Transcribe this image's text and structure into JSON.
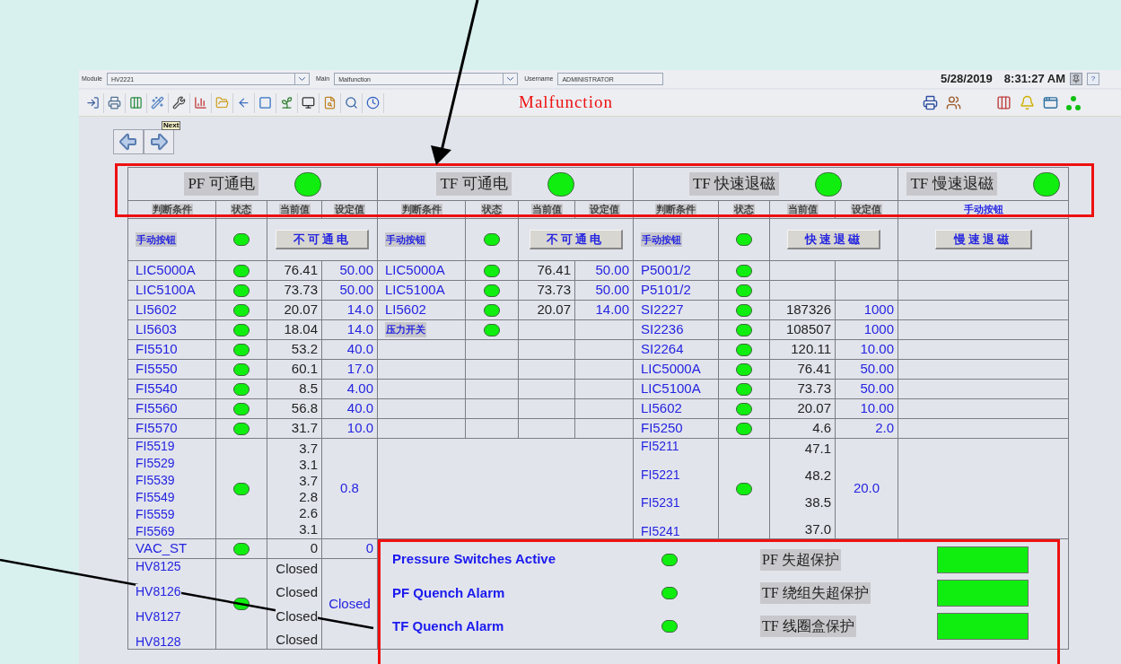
{
  "top_bar": {
    "module_label": "Module",
    "module": "HV2221",
    "main_label": "Main",
    "main": "Malfunction",
    "username_label": "Username",
    "username": "ADMINISTRATOR",
    "date": "5/28/2019",
    "time": "8:31:27 AM",
    "help": "?"
  },
  "page_title": "Malfunction",
  "next_tooltip": "Next",
  "sections": [
    {
      "title": "PF 可通电",
      "on": true,
      "columns": [
        {
          "label": "判断条件",
          "kind": "plain"
        },
        {
          "label": "状态",
          "kind": "plain"
        },
        {
          "label": "当前值",
          "kind": "plain"
        },
        {
          "label": "设定值",
          "kind": "plain"
        }
      ],
      "manual_label": "手动按钮",
      "manual_on": true,
      "button": "不可通电"
    },
    {
      "title": "TF 可通电",
      "on": true,
      "columns": [
        {
          "label": "判断条件",
          "kind": "plain"
        },
        {
          "label": "状态",
          "kind": "plain"
        },
        {
          "label": "当前值",
          "kind": "plain"
        },
        {
          "label": "设定值",
          "kind": "plain"
        }
      ],
      "manual_label": "手动按钮",
      "manual_on": true,
      "button": "不可通电"
    },
    {
      "title": "TF 快速退磁",
      "on": true,
      "columns": [
        {
          "label": "判断条件",
          "kind": "plain"
        },
        {
          "label": "状态",
          "kind": "plain"
        },
        {
          "label": "当前值",
          "kind": "plain"
        },
        {
          "label": "设定值",
          "kind": "plain"
        }
      ],
      "manual_label": "手动按钮",
      "manual_on": true,
      "button": "快速退磁"
    },
    {
      "title": "TF 慢速退磁",
      "on": true,
      "columns": [
        {
          "label": "手动按钮",
          "kind": "link"
        }
      ],
      "button": "慢速退磁"
    }
  ],
  "pf_rows": [
    {
      "kind": "single",
      "tag": "LIC5000A",
      "on": true,
      "value": "76.41",
      "setpoint": "50.00"
    },
    {
      "kind": "single",
      "tag": "LIC5100A",
      "on": true,
      "value": "73.73",
      "setpoint": "50.00"
    },
    {
      "kind": "single",
      "tag": "LI5602",
      "on": true,
      "value": "20.07",
      "setpoint": "14.0"
    },
    {
      "kind": "single",
      "tag": "LI5603",
      "on": true,
      "value": "18.04",
      "setpoint": "14.0"
    },
    {
      "kind": "single",
      "tag": "FI5510",
      "on": true,
      "value": "53.2",
      "setpoint": "40.0"
    },
    {
      "kind": "single",
      "tag": "FI5550",
      "on": true,
      "value": "60.1",
      "setpoint": "17.0"
    },
    {
      "kind": "single",
      "tag": "FI5540",
      "on": true,
      "value": "8.5",
      "setpoint": "4.00"
    },
    {
      "kind": "single",
      "tag": "FI5560",
      "on": true,
      "value": "56.8",
      "setpoint": "40.0"
    },
    {
      "kind": "single",
      "tag": "FI5570",
      "on": true,
      "value": "31.7",
      "setpoint": "10.0"
    },
    {
      "kind": "group",
      "tags": [
        "FI5519",
        "FI5529",
        "FI5539",
        "FI5549",
        "FI5559",
        "FI5569"
      ],
      "on": true,
      "values": [
        "3.7",
        "3.1",
        "3.7",
        "2.8",
        "2.6",
        "3.1"
      ],
      "setpoint": "0.8"
    },
    {
      "kind": "single",
      "tag": "VAC_ST",
      "on": true,
      "value": "0",
      "setpoint": "0"
    },
    {
      "kind": "group",
      "tags": [
        "HV8125",
        "HV8126",
        "HV8127",
        "HV8128"
      ],
      "on": true,
      "values": [
        "Closed",
        "Closed",
        "Closed",
        "Closed"
      ],
      "setpoint": "Closed"
    }
  ],
  "tf_rows": [
    {
      "kind": "single",
      "tag": "LIC5000A",
      "on": true,
      "value": "76.41",
      "setpoint": "50.00"
    },
    {
      "kind": "single",
      "tag": "LIC5100A",
      "on": true,
      "value": "73.73",
      "setpoint": "50.00"
    },
    {
      "kind": "single",
      "tag": "LI5602",
      "on": true,
      "value": "20.07",
      "setpoint": "14.00"
    },
    {
      "kind": "label",
      "tag": "压力开关",
      "on": true
    }
  ],
  "fast_rows": [
    {
      "kind": "single",
      "tag": "P5001/2",
      "on": true
    },
    {
      "kind": "single",
      "tag": "P5101/2",
      "on": true
    },
    {
      "kind": "single",
      "tag": "SI2227",
      "on": true,
      "value": "187326",
      "setpoint": "1000"
    },
    {
      "kind": "single",
      "tag": "SI2236",
      "on": true,
      "value": "108507",
      "setpoint": "1000"
    },
    {
      "kind": "single",
      "tag": "SI2264",
      "on": true,
      "value": "120.11",
      "setpoint": "10.00"
    },
    {
      "kind": "single",
      "tag": "LIC5000A",
      "on": true,
      "value": "76.41",
      "setpoint": "50.00"
    },
    {
      "kind": "single",
      "tag": "LIC5100A",
      "on": true,
      "value": "73.73",
      "setpoint": "50.00"
    },
    {
      "kind": "single",
      "tag": "LI5602",
      "on": true,
      "value": "20.07",
      "setpoint": "10.00"
    },
    {
      "kind": "single",
      "tag": "FI5250",
      "on": true,
      "value": "4.6",
      "setpoint": "2.0"
    },
    {
      "kind": "group",
      "tags": [
        "FI5211",
        "FI5221",
        "FI5231",
        "FI5241"
      ],
      "on": true,
      "values": [
        "47.1",
        "48.2",
        "38.5",
        "37.0"
      ],
      "setpoint": "20.0"
    }
  ],
  "alarms": [
    {
      "label": "Pressure Switches Active",
      "on": true
    },
    {
      "label": "PF Quench Alarm",
      "on": true
    },
    {
      "label": "TF Quench Alarm",
      "on": true
    }
  ],
  "protections": [
    {
      "label": "PF 失超保护",
      "on": true
    },
    {
      "label": "TF 绕组失超保护",
      "on": true
    },
    {
      "label": "TF 线圈盒保护",
      "on": true
    }
  ]
}
